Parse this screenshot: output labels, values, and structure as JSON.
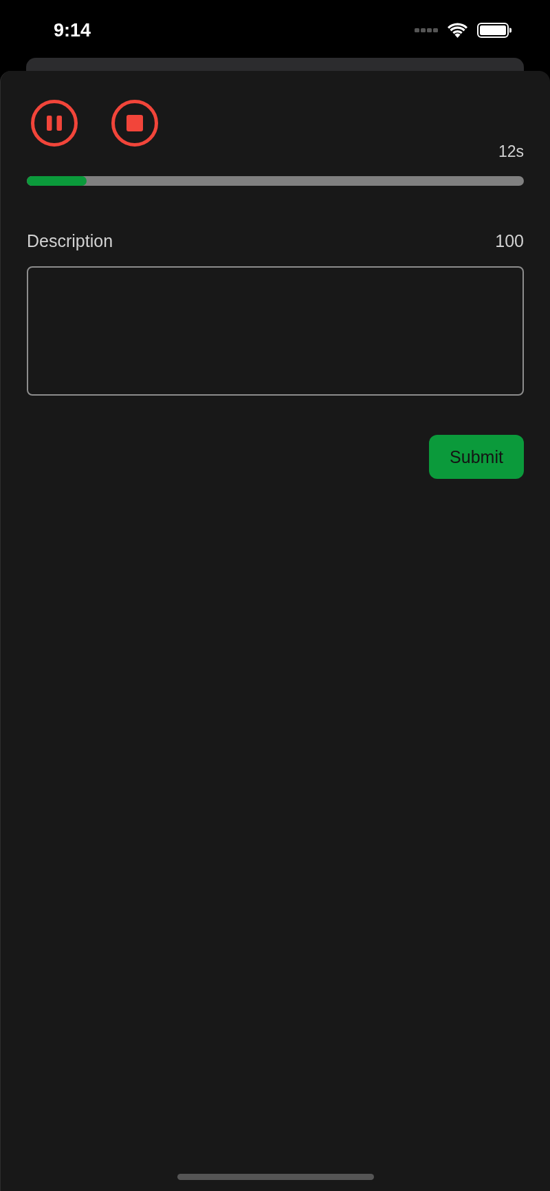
{
  "status_bar": {
    "time": "9:14"
  },
  "recorder": {
    "timer": "12s",
    "progress": {
      "level": 0.12
    }
  },
  "description": {
    "label": "Description",
    "counter": "100"
  },
  "submit_button": {
    "label": "Submit"
  }
}
